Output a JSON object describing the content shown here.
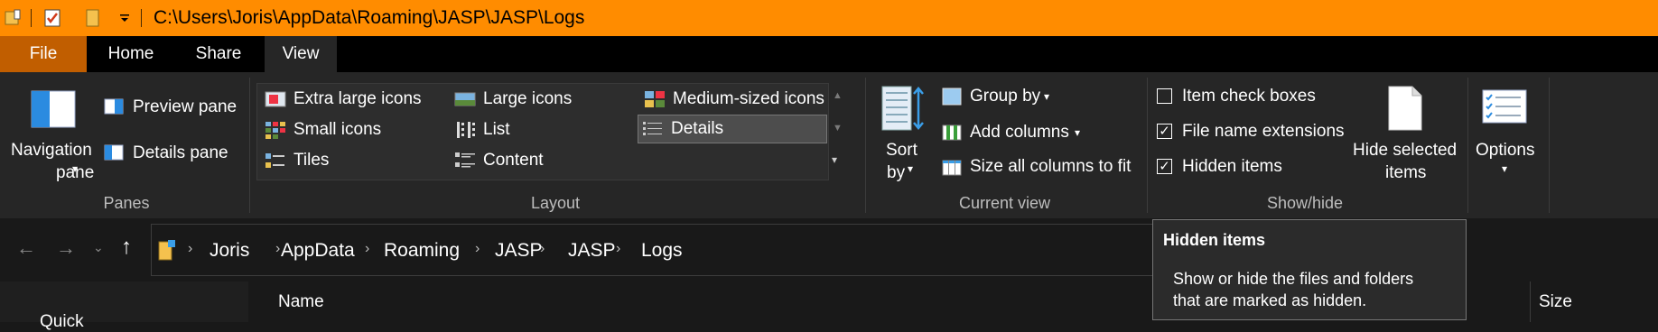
{
  "titlebar": {
    "path": "C:\\Users\\Joris\\AppData\\Roaming\\JASP\\JASP\\Logs",
    "quick_access": [
      "properties-icon",
      "new-folder-icon",
      "customize-dropdown-icon"
    ]
  },
  "tabs": [
    {
      "label": "File"
    },
    {
      "label": "Home"
    },
    {
      "label": "Share"
    },
    {
      "label": "View"
    }
  ],
  "ribbon": {
    "panes": {
      "group_label": "Panes",
      "navigation_pane_line1": "Navigation",
      "navigation_pane_line2": "pane",
      "preview_pane": "Preview pane",
      "details_pane": "Details pane"
    },
    "layout": {
      "group_label": "Layout",
      "items": {
        "extra_large": "Extra large icons",
        "large": "Large icons",
        "medium": "Medium-sized icons",
        "small": "Small icons",
        "list": "List",
        "details": "Details",
        "tiles": "Tiles",
        "content": "Content"
      },
      "selected": "Details"
    },
    "current_view": {
      "group_label": "Current view",
      "sort_by_line1": "Sort",
      "sort_by_line2": "by",
      "group_by": "Group by",
      "add_columns": "Add columns",
      "size_all_columns": "Size all columns to fit"
    },
    "show_hide": {
      "group_label": "Show/hide",
      "item_check_boxes": {
        "label": "Item check boxes",
        "checked": false
      },
      "file_name_extensions": {
        "label": "File name extensions",
        "checked": true
      },
      "hidden_items": {
        "label": "Hidden items",
        "checked": true
      },
      "hide_selected_line1": "Hide selected",
      "hide_selected_line2": "items"
    },
    "options": {
      "label": "Options"
    }
  },
  "breadcrumb": [
    "Joris",
    "AppData",
    "Roaming",
    "JASP",
    "JASP",
    "Logs"
  ],
  "columns": {
    "name": "Name",
    "size": "Size"
  },
  "sidebar": {
    "first_item_partial": "Quick"
  },
  "tooltip": {
    "title": "Hidden items",
    "line1": "Show or hide the files and folders",
    "line2": "that are marked as hidden."
  },
  "colors": {
    "titlebar": "#ff8c00",
    "file_tab": "#c15e00",
    "ribbon": "#262626",
    "background": "#191919"
  }
}
